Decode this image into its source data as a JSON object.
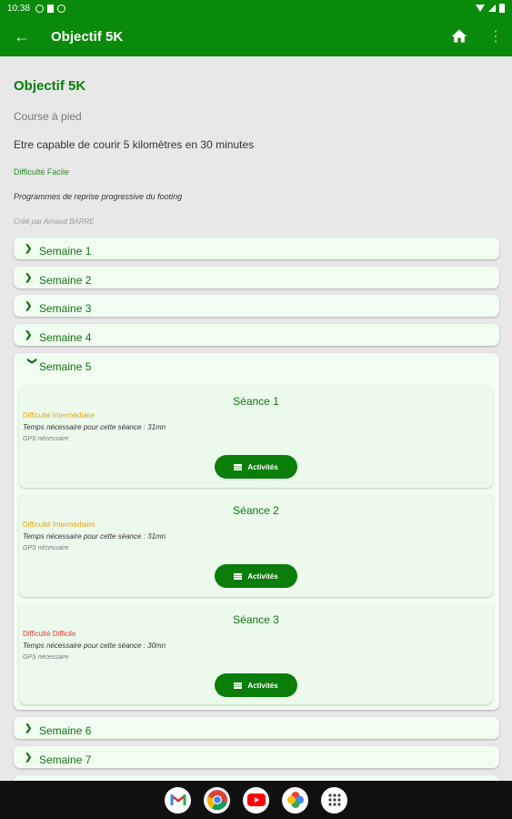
{
  "status_bar": {
    "time": "10:38"
  },
  "app_bar": {
    "title": "Objectif 5K"
  },
  "program": {
    "title": "Objectif 5K",
    "sport": "Course à pied",
    "goal": "Etre capable de courir 5 kilomètres en 30 minutes",
    "difficulty": "Difficulté Facile",
    "description": "Programmes de reprise progressive du footing",
    "author": "Créé par Arnaud BARRE"
  },
  "weeks": [
    {
      "label": "Semaine 1",
      "expanded": false
    },
    {
      "label": "Semaine 2",
      "expanded": false
    },
    {
      "label": "Semaine 3",
      "expanded": false
    },
    {
      "label": "Semaine 4",
      "expanded": false
    },
    {
      "label": "Semaine 5",
      "expanded": true
    },
    {
      "label": "Semaine 6",
      "expanded": false
    },
    {
      "label": "Semaine 7",
      "expanded": false
    }
  ],
  "sessions": [
    {
      "title": "Séance 1",
      "difficulty": "Difficulté Intermédiaire",
      "difficulty_color": "#e8a317",
      "time": "Temps nécessaire pour cette séance : 31mn",
      "gps": "GPS nécessaire",
      "button": "Activités"
    },
    {
      "title": "Séance 2",
      "difficulty": "Difficulté Intermédiaire",
      "difficulty_color": "#e8a317",
      "time": "Temps nécessaire pour cette séance : 31mn",
      "gps": "GPS nécessaire",
      "button": "Activités"
    },
    {
      "title": "Séance 3",
      "difficulty": "Difficulté Difficile",
      "difficulty_color": "#e53935",
      "time": "Temps nécessaire pour cette séance : 30mn",
      "gps": "GPS nécessaire",
      "button": "Activités"
    }
  ],
  "icons": {
    "back": "arrow-back-icon",
    "home": "home-icon",
    "more": "more-vert-icon",
    "collapsed": "chevron-right-icon",
    "expanded": "chevron-down-icon",
    "activities": "list-icon"
  },
  "dock": [
    "Gmail",
    "Chrome",
    "YouTube",
    "Photos",
    "Apps"
  ],
  "colors": {
    "primary": "#0a8a0a",
    "card": "#f1fdf1",
    "intermediate": "#e8a317",
    "hard": "#e53935"
  }
}
